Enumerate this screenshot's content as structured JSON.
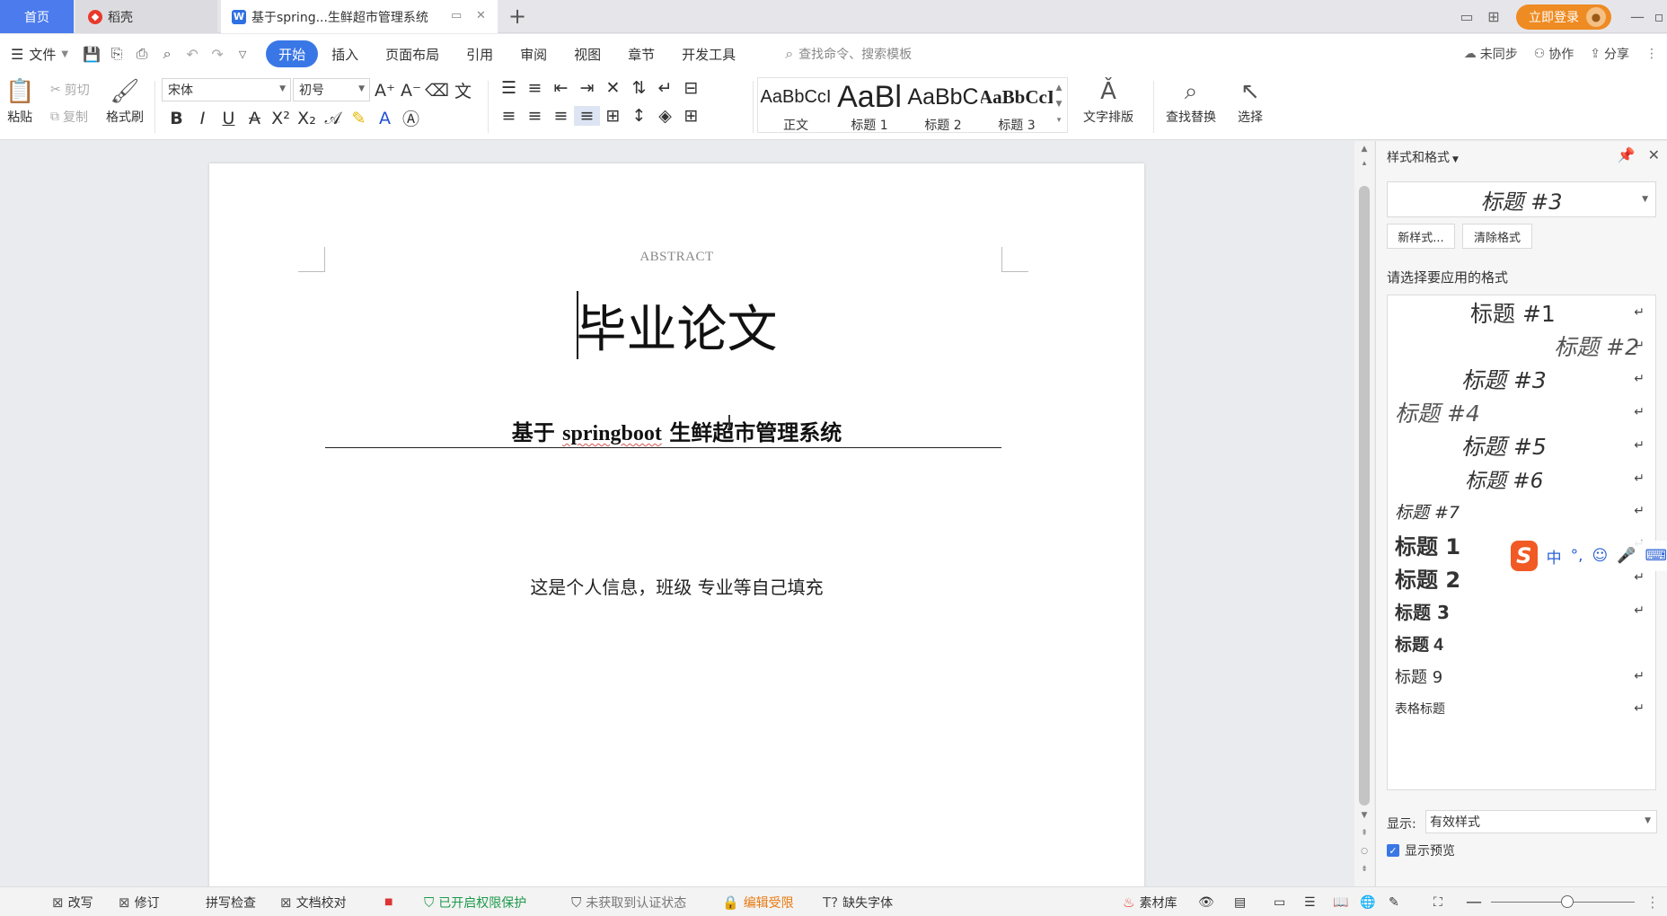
{
  "tabs": {
    "home": "首页",
    "daoke": "稻壳",
    "doc": "基于spring...生鲜超市管理系统",
    "new_tab": "+"
  },
  "topright": {
    "login": "立即登录"
  },
  "menubar": {
    "file": "文件",
    "tabs": [
      "开始",
      "插入",
      "页面布局",
      "引用",
      "审阅",
      "视图",
      "章节",
      "开发工具"
    ],
    "search_placeholder": "查找命令、搜索模板",
    "unsynced": "未同步",
    "collab": "协作",
    "share": "分享"
  },
  "ribbon": {
    "paste": "粘贴",
    "cut": "剪切",
    "copy": "复制",
    "format_painter": "格式刷",
    "font_name": "宋体",
    "font_size": "初号",
    "styles": [
      {
        "preview": "AaBbCcI",
        "label": "正文"
      },
      {
        "preview": "AaBl",
        "label": "标题 1"
      },
      {
        "preview": "AaBbC",
        "label": "标题 2"
      },
      {
        "preview": "AaBbCcI",
        "label": "标题 3"
      }
    ],
    "text_layout": "文字排版",
    "find_replace": "查找替换",
    "select": "选择"
  },
  "document": {
    "abstract": "ABSTRACT",
    "title": "毕业论文",
    "subtitle_pre": "基于 ",
    "subtitle_word": "springboot",
    "subtitle_post": " 生鲜超市管理系统",
    "info": "这是个人信息，班级 专业等自己填充"
  },
  "panel": {
    "header": "样式和格式",
    "current_style": "标题 #3",
    "new_style": "新样式...",
    "clear_format": "清除格式",
    "choose_label": "请选择要应用的格式",
    "styles": [
      "标题 #1",
      "标题 #2",
      "标题 #3",
      "标题 #4",
      "标题 #5",
      "标题 #6",
      "标题 #7",
      "标题 1",
      "标题 2",
      "标题 3",
      "标题 4",
      "标题 9",
      "表格标题"
    ],
    "show_label": "显示:",
    "show_value": "有效样式",
    "preview": "显示预览"
  },
  "ime": {
    "mode": "中"
  },
  "statusbar": {
    "rewrite": "改写",
    "revise": "修订",
    "spell": "拼写检查",
    "proof": "文档校对",
    "protect": "已开启权限保护",
    "cert": "未获取到认证状态",
    "edit_limit": "编辑受限",
    "missing_font": "缺失字体",
    "materials": "素材库"
  },
  "icons": {
    "home": "home-icon",
    "daoke": "daoke-logo-icon",
    "doc": "writer-doc-icon"
  }
}
